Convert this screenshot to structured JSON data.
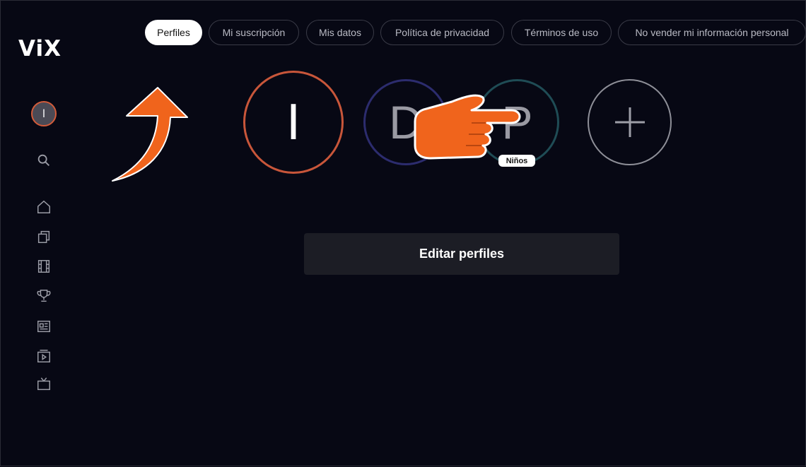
{
  "brand": {
    "logo_text": "ViX"
  },
  "sidebar": {
    "avatar_letter": "I",
    "icons": [
      "search-icon",
      "home-icon",
      "collections-icon",
      "movies-icon",
      "trophy-icon",
      "news-icon",
      "play-icon",
      "tv-icon"
    ]
  },
  "tabs": [
    "Perfiles",
    "Mi suscripción",
    "Mis datos",
    "Política de privacidad",
    "Términos de uso",
    "No vender mi información personal"
  ],
  "profiles": [
    {
      "letter": "I",
      "ring_color": "#c8563a"
    },
    {
      "letter": "D",
      "ring_color": "#2c2c6e"
    },
    {
      "letter": "P",
      "ring_color": "#1f4c55",
      "badge": "Niños"
    },
    {
      "letter": "+",
      "ring_color": "#8e8f98"
    }
  ],
  "edit_button_label": "Editar perfiles",
  "colors": {
    "background": "#070814",
    "accent_overlay": "#f0641c"
  }
}
